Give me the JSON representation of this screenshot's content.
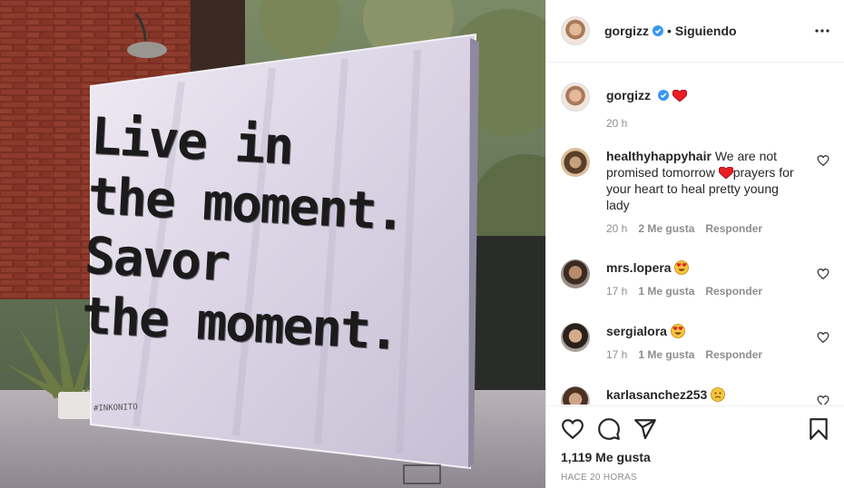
{
  "photo": {
    "wall_lines": [
      "Live in",
      "the moment.",
      "Savor",
      "the moment."
    ],
    "wall_tag": "#INKONITO"
  },
  "header": {
    "username": "gorgizz",
    "separator": "•",
    "follow_label": "Siguiendo",
    "more_label": "•••"
  },
  "caption": {
    "username": "gorgizz",
    "time": "20 h"
  },
  "comments": [
    {
      "username": "healthyhappyhair",
      "text_before": "We are not promised tomorrow ",
      "text_after": "prayers for your heart to heal pretty young lady",
      "time": "20 h",
      "likes": "2 Me gusta",
      "reply": "Responder"
    },
    {
      "username": "mrs.lopera",
      "time": "17 h",
      "likes": "1 Me gusta",
      "reply": "Responder"
    },
    {
      "username": "sergialora",
      "time": "17 h",
      "likes": "1 Me gusta",
      "reply": "Responder"
    },
    {
      "username": "karlasanchez253"
    }
  ],
  "footer": {
    "likes_count": "1,119 Me gusta",
    "timestamp": "HACE 20 HORAS"
  },
  "colors": {
    "verified": "#3897f0",
    "heart_red": "#ed1c24",
    "muted": "#8e8e8e",
    "border": "#efefef"
  },
  "icons": [
    "heart-icon",
    "comment-icon",
    "share-icon",
    "bookmark-icon",
    "verified-icon",
    "more-icon"
  ]
}
